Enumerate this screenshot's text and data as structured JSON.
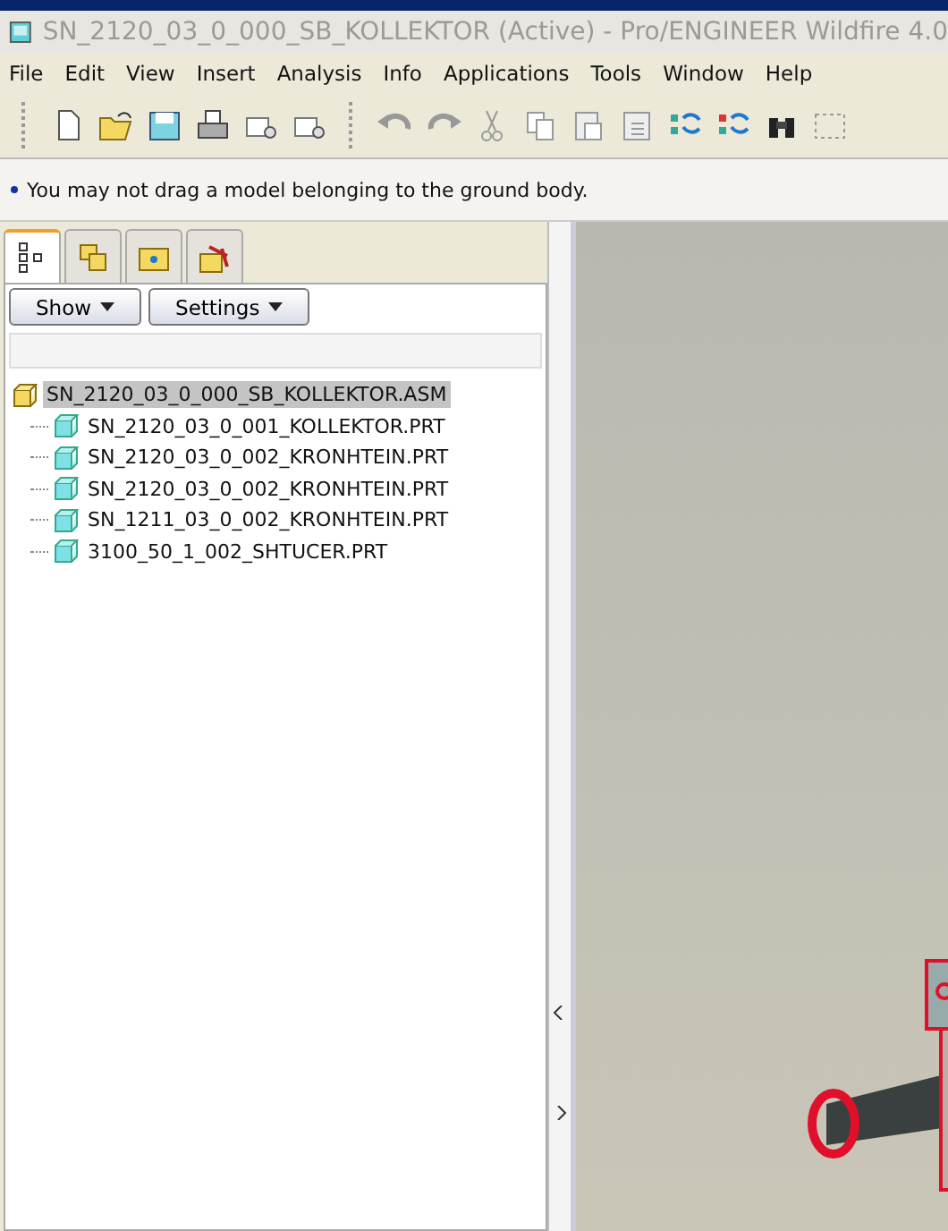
{
  "window": {
    "title": "SN_2120_03_0_000_SB_KOLLEKTOR (Active) - Pro/ENGINEER Wildfire 4.0"
  },
  "menu": [
    "File",
    "Edit",
    "View",
    "Insert",
    "Analysis",
    "Info",
    "Applications",
    "Tools",
    "Window",
    "Help"
  ],
  "message": "You may not drag a model belonging to the ground body.",
  "panel_tabs": [
    {
      "selected": true
    },
    {
      "selected": false
    },
    {
      "selected": false
    },
    {
      "selected": false
    }
  ],
  "panel_buttons": [
    {
      "label": "Show"
    },
    {
      "label": "Settings"
    }
  ],
  "tree": {
    "label": "SN_2120_03_0_000_SB_KOLLEKTOR.ASM",
    "selected": true,
    "children": [
      {
        "label": "SN_2120_03_0_001_KOLLEKTOR.PRT",
        "selected": false
      },
      {
        "label": "SN_2120_03_0_002_KRONHTEIN.PRT",
        "selected": false
      },
      {
        "label": "SN_2120_03_0_002_KRONHTEIN.PRT",
        "selected": false
      },
      {
        "label": "SN_1211_03_0_002_KRONHTEIN.PRT",
        "selected": false
      },
      {
        "label": "3100_50_1_002_SHTUCER.PRT",
        "selected": false
      }
    ]
  }
}
